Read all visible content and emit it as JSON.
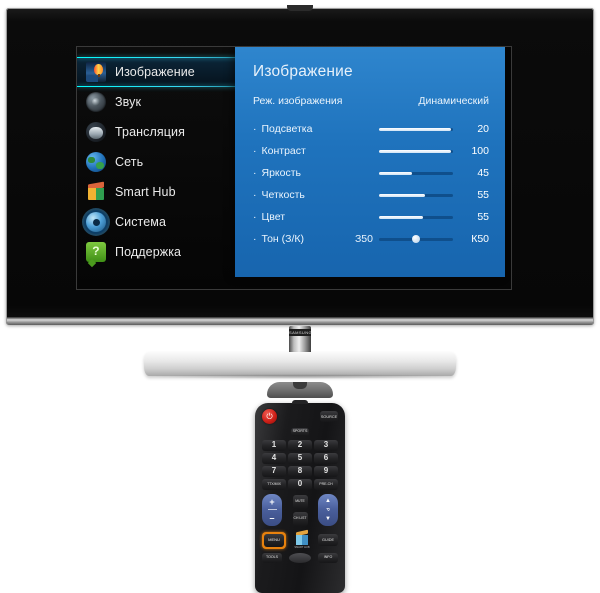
{
  "tv": {
    "brand": "SAMSUNG",
    "menu": {
      "items": [
        {
          "label": "Изображение",
          "icon": "picture-icon",
          "selected": true
        },
        {
          "label": "Звук",
          "icon": "sound-icon",
          "selected": false
        },
        {
          "label": "Трансляция",
          "icon": "broadcast-icon",
          "selected": false
        },
        {
          "label": "Сеть",
          "icon": "network-icon",
          "selected": false
        },
        {
          "label": "Smart Hub",
          "icon": "smart-hub-icon",
          "selected": false
        },
        {
          "label": "Система",
          "icon": "gear-icon",
          "selected": false
        },
        {
          "label": "Поддержка",
          "icon": "support-icon",
          "selected": false
        }
      ]
    },
    "panel": {
      "title": "Изображение",
      "mode_label": "Реж. изображения",
      "mode_value": "Динамический",
      "settings": [
        {
          "label": "Подсветка",
          "bullet": "·",
          "value": "20",
          "percent": 97,
          "prefix": ""
        },
        {
          "label": "Контраст",
          "bullet": "·",
          "value": "100",
          "percent": 97,
          "prefix": ""
        },
        {
          "label": "Яркость",
          "bullet": "·",
          "value": "45",
          "percent": 45,
          "prefix": ""
        },
        {
          "label": "Четкость",
          "bullet": "·",
          "value": "55",
          "percent": 62,
          "prefix": ""
        },
        {
          "label": "Цвет",
          "bullet": "·",
          "value": "55",
          "percent": 60,
          "prefix": ""
        },
        {
          "label": "Тон (З/К)",
          "bullet": "·",
          "value": "К50",
          "percent": 50,
          "prefix": "З50",
          "knob": true
        }
      ]
    },
    "colors": {
      "panel_blue": "#1f73bd",
      "highlight_cyan": "#2fd4ee",
      "menu_background": "#0a0a0a",
      "slider_fill": "#ffffff",
      "slider_track": "#0f4f8c"
    }
  },
  "remote": {
    "power_label": "⏻",
    "source_label": "SOURCE",
    "sports_label": "SPORTS",
    "keypad": [
      "1",
      "2",
      "3",
      "4",
      "5",
      "6",
      "7",
      "8",
      "9",
      "TTX/MIX",
      "0",
      "PRE-CH"
    ],
    "volume_plus": "+",
    "volume_minus": "–",
    "mute_label": "MUTE",
    "chlist_label": "CH LIST",
    "channel_label": "P",
    "menu_label": "MENU",
    "smart_hub_label": "SMART HUB",
    "guide_label": "GUIDE",
    "tools_label": "TOOLS",
    "info_label": "INFO",
    "highlight_color": "#e8820e"
  }
}
